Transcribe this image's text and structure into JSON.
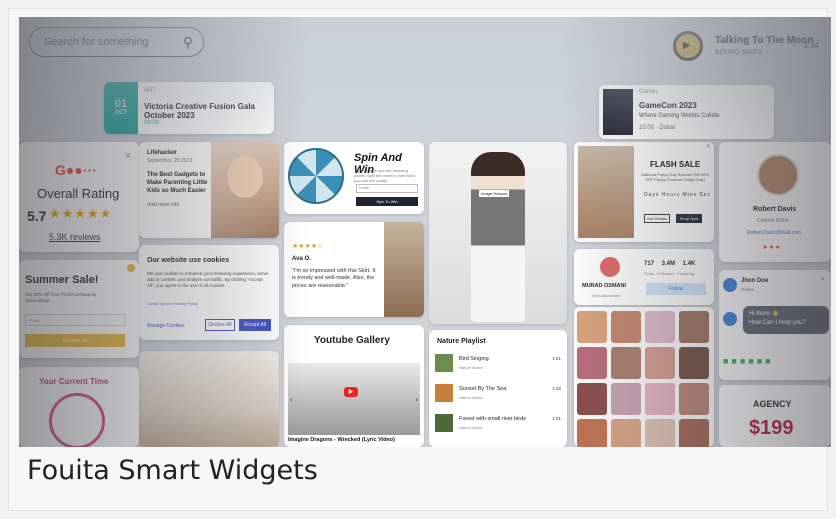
{
  "search": {
    "placeholder": "Search for something"
  },
  "music": {
    "title": "Talking To The Moon",
    "artist": "BRUNO MARS",
    "time": "3:34"
  },
  "event": {
    "day": "01",
    "month": "OCT",
    "tag": "ART",
    "title": "Victoria Creative Fusion Gala October 2023",
    "time": "09:00"
  },
  "game": {
    "tag": "Games",
    "title": "GameCon 2023",
    "subtitle": "Where Gaming Worlds Collide",
    "time": "10:00 · Dubai"
  },
  "rating": {
    "brand": "G●●···",
    "heading": "Overall Rating",
    "score": "5.7",
    "stars": "★★★★★",
    "reviews": "5.3K reviews",
    "close": "×"
  },
  "news": {
    "source": "Lifehacker",
    "date": "September, 28 2023",
    "title": "The Best Gadgets to Make Parenting Little Kids so Much Easier",
    "more": "read more info"
  },
  "spin": {
    "heading": "Spin And Win",
    "sub": "Try your luck and win amazing prizes. Spin the wheel to see what you can win today!",
    "email": "Email",
    "button": "Spin To Win"
  },
  "review": {
    "stars": "★★★★☆",
    "name": "Ava O.",
    "text": "\"I'm so impressed with this Skirt. It is trendy and well-made. Also, the prices are reasonable.\""
  },
  "model": {
    "tip": "Image Hotspot"
  },
  "flash": {
    "heading": "FLASH SALE",
    "sub": "National Puppy Day Special! Get 20% OFF Puppy Products Today Only!",
    "countdown": "Days Hours Mins Sec",
    "more": "Get Details",
    "shop": "Shop Now",
    "close": "×"
  },
  "profile": {
    "name": "Robert Davis",
    "role": "Content Writer",
    "email": "Robert.Davis@mail.com",
    "social": "●●●"
  },
  "cookie": {
    "heading": "Our website use cookies",
    "text": "We use cookies to enhance your browsing experience, serve ads or content, and analyze our traffic. By clicking \"Accept All\", you agree to the use of all cookies.",
    "link": "Check out our Privacy Policy",
    "manage": "Manage Cookies",
    "decline": "Decline All",
    "accept": "Accept All"
  },
  "sale": {
    "heading": "Summer Sale!",
    "text": "Get 30% Off Your First Purchase by Subscribing!",
    "email": "Email",
    "button": "Get 30% Off"
  },
  "artist": {
    "name": "MURAD OSMANI",
    "handle": "@muradosmani",
    "stats": "717 3.4M 1.4K",
    "labels": "Posts Followers Following",
    "follow": "Follow"
  },
  "chat": {
    "name": "Jhon Doe",
    "status": "Online",
    "close": "×",
    "msg1": "Hi there 👋",
    "msg2": "How Can I Help you?",
    "apps": "■■■■■■"
  },
  "youtube": {
    "heading": "Youtube Gallery",
    "caption": "Imagine Dragons - Wrecked (Lyric Video)",
    "play": "▶",
    "left": "‹",
    "right": "›"
  },
  "playlist": {
    "heading": "Nature Playlist",
    "items": [
      {
        "title": "Bird Singing",
        "sub": "Nature Music",
        "dur": "1:51"
      },
      {
        "title": "Sunset By The Sea",
        "sub": "Nature Music",
        "dur": "1:28"
      },
      {
        "title": "Forest with small river birds",
        "sub": "Nature Music",
        "dur": "1:51"
      }
    ]
  },
  "clock": {
    "heading": "Your Current Time"
  },
  "agency": {
    "heading": "AGENCY",
    "price": "$199"
  },
  "caption": "Fouita Smart Widgets"
}
